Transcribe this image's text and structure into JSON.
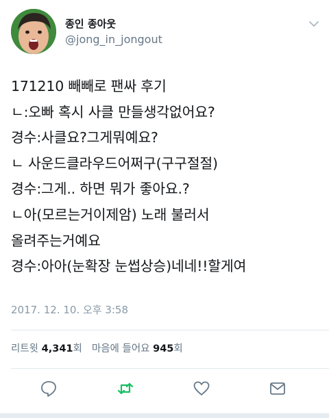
{
  "author": {
    "display_name": "종인 종아웃",
    "handle": "@jong_in_jongout"
  },
  "tweet": {
    "lines": [
      "171210 빼빼로 팬싸 후기",
      "ㄴ:오빠 혹시 사클 만들생각없어요?",
      "경수:사클요?그게뭐예요?",
      "ㄴ 사운드클라우드어쩌구(구구절절)",
      "경수:그게.. 하면 뭐가 좋아요.?",
      "ㄴ아(모르는거이제암) 노래 불러서",
      "올려주는거예요",
      "경수:아아(눈확장 눈썹상승)네네!!할게여"
    ],
    "timestamp": "2017. 12. 10. 오후 3:58"
  },
  "stats": {
    "retweets_label": "리트윗",
    "retweets_count": "4,341",
    "retweets_unit": "회",
    "likes_label": "마음에 들어요",
    "likes_count": "945",
    "likes_unit": "회"
  },
  "icons": {
    "caret": "chevron-down-icon",
    "reply": "reply-icon",
    "retweet": "retweet-icon",
    "like": "heart-icon",
    "message": "envelope-icon"
  },
  "colors": {
    "text": "#14171a",
    "secondary": "#657786",
    "muted": "#8899a6",
    "retweet_green": "#17bf63",
    "divider": "#e1e8ed"
  }
}
